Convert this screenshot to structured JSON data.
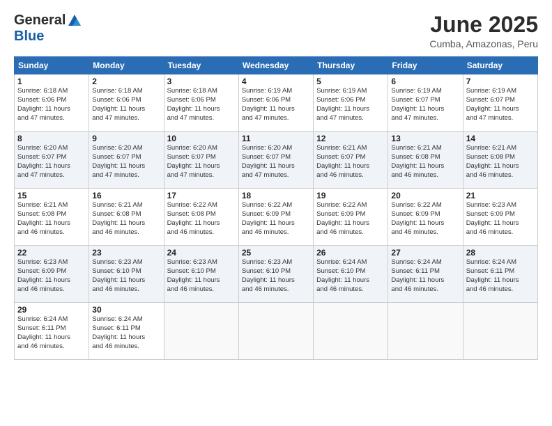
{
  "header": {
    "logo_general": "General",
    "logo_blue": "Blue",
    "month_title": "June 2025",
    "subtitle": "Cumba, Amazonas, Peru"
  },
  "calendar": {
    "days_of_week": [
      "Sunday",
      "Monday",
      "Tuesday",
      "Wednesday",
      "Thursday",
      "Friday",
      "Saturday"
    ],
    "weeks": [
      [
        {
          "day": "",
          "info": ""
        },
        {
          "day": "2",
          "info": "Sunrise: 6:18 AM\nSunset: 6:06 PM\nDaylight: 11 hours and 47 minutes."
        },
        {
          "day": "3",
          "info": "Sunrise: 6:18 AM\nSunset: 6:06 PM\nDaylight: 11 hours and 47 minutes."
        },
        {
          "day": "4",
          "info": "Sunrise: 6:19 AM\nSunset: 6:06 PM\nDaylight: 11 hours and 47 minutes."
        },
        {
          "day": "5",
          "info": "Sunrise: 6:19 AM\nSunset: 6:06 PM\nDaylight: 11 hours and 47 minutes."
        },
        {
          "day": "6",
          "info": "Sunrise: 6:19 AM\nSunset: 6:07 PM\nDaylight: 11 hours and 47 minutes."
        },
        {
          "day": "7",
          "info": "Sunrise: 6:19 AM\nSunset: 6:07 PM\nDaylight: 11 hours and 47 minutes."
        }
      ],
      [
        {
          "day": "1",
          "info": "Sunrise: 6:18 AM\nSunset: 6:06 PM\nDaylight: 11 hours and 47 minutes."
        },
        {
          "day": "9",
          "info": "Sunrise: 6:20 AM\nSunset: 6:07 PM\nDaylight: 11 hours and 47 minutes."
        },
        {
          "day": "10",
          "info": "Sunrise: 6:20 AM\nSunset: 6:07 PM\nDaylight: 11 hours and 47 minutes."
        },
        {
          "day": "11",
          "info": "Sunrise: 6:20 AM\nSunset: 6:07 PM\nDaylight: 11 hours and 47 minutes."
        },
        {
          "day": "12",
          "info": "Sunrise: 6:21 AM\nSunset: 6:07 PM\nDaylight: 11 hours and 46 minutes."
        },
        {
          "day": "13",
          "info": "Sunrise: 6:21 AM\nSunset: 6:08 PM\nDaylight: 11 hours and 46 minutes."
        },
        {
          "day": "14",
          "info": "Sunrise: 6:21 AM\nSunset: 6:08 PM\nDaylight: 11 hours and 46 minutes."
        }
      ],
      [
        {
          "day": "8",
          "info": "Sunrise: 6:20 AM\nSunset: 6:07 PM\nDaylight: 11 hours and 47 minutes."
        },
        {
          "day": "16",
          "info": "Sunrise: 6:21 AM\nSunset: 6:08 PM\nDaylight: 11 hours and 46 minutes."
        },
        {
          "day": "17",
          "info": "Sunrise: 6:22 AM\nSunset: 6:08 PM\nDaylight: 11 hours and 46 minutes."
        },
        {
          "day": "18",
          "info": "Sunrise: 6:22 AM\nSunset: 6:09 PM\nDaylight: 11 hours and 46 minutes."
        },
        {
          "day": "19",
          "info": "Sunrise: 6:22 AM\nSunset: 6:09 PM\nDaylight: 11 hours and 46 minutes."
        },
        {
          "day": "20",
          "info": "Sunrise: 6:22 AM\nSunset: 6:09 PM\nDaylight: 11 hours and 46 minutes."
        },
        {
          "day": "21",
          "info": "Sunrise: 6:23 AM\nSunset: 6:09 PM\nDaylight: 11 hours and 46 minutes."
        }
      ],
      [
        {
          "day": "15",
          "info": "Sunrise: 6:21 AM\nSunset: 6:08 PM\nDaylight: 11 hours and 46 minutes."
        },
        {
          "day": "23",
          "info": "Sunrise: 6:23 AM\nSunset: 6:10 PM\nDaylight: 11 hours and 46 minutes."
        },
        {
          "day": "24",
          "info": "Sunrise: 6:23 AM\nSunset: 6:10 PM\nDaylight: 11 hours and 46 minutes."
        },
        {
          "day": "25",
          "info": "Sunrise: 6:23 AM\nSunset: 6:10 PM\nDaylight: 11 hours and 46 minutes."
        },
        {
          "day": "26",
          "info": "Sunrise: 6:24 AM\nSunset: 6:10 PM\nDaylight: 11 hours and 46 minutes."
        },
        {
          "day": "27",
          "info": "Sunrise: 6:24 AM\nSunset: 6:11 PM\nDaylight: 11 hours and 46 minutes."
        },
        {
          "day": "28",
          "info": "Sunrise: 6:24 AM\nSunset: 6:11 PM\nDaylight: 11 hours and 46 minutes."
        }
      ],
      [
        {
          "day": "22",
          "info": "Sunrise: 6:23 AM\nSunset: 6:09 PM\nDaylight: 11 hours and 46 minutes."
        },
        {
          "day": "30",
          "info": "Sunrise: 6:24 AM\nSunset: 6:11 PM\nDaylight: 11 hours and 46 minutes."
        },
        {
          "day": "",
          "info": ""
        },
        {
          "day": "",
          "info": ""
        },
        {
          "day": "",
          "info": ""
        },
        {
          "day": "",
          "info": ""
        },
        {
          "day": "",
          "info": ""
        }
      ],
      [
        {
          "day": "29",
          "info": "Sunrise: 6:24 AM\nSunset: 6:11 PM\nDaylight: 11 hours and 46 minutes."
        },
        {
          "day": "",
          "info": ""
        },
        {
          "day": "",
          "info": ""
        },
        {
          "day": "",
          "info": ""
        },
        {
          "day": "",
          "info": ""
        },
        {
          "day": "",
          "info": ""
        },
        {
          "day": "",
          "info": ""
        }
      ]
    ]
  }
}
